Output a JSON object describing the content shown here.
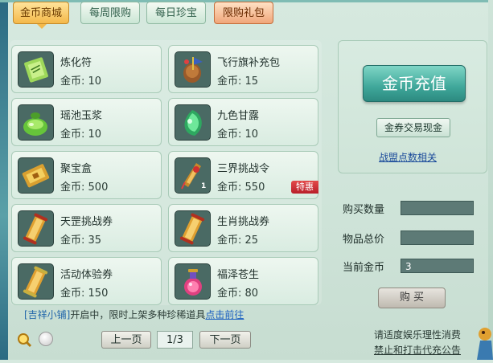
{
  "tabs": [
    {
      "label": "金币商城",
      "state": "active"
    },
    {
      "label": "每周限购",
      "state": "normal"
    },
    {
      "label": "每日珍宝",
      "state": "normal"
    },
    {
      "label": "限购礼包",
      "state": "highlight"
    }
  ],
  "currency_label": "金币:",
  "items": [
    {
      "name": "炼化符",
      "price": "10",
      "icon": "green-talisman-icon"
    },
    {
      "name": "飞行旗补充包",
      "price": "15",
      "icon": "flag-pack-icon"
    },
    {
      "name": "瑶池玉浆",
      "price": "10",
      "icon": "green-jade-pot-icon"
    },
    {
      "name": "九色甘露",
      "price": "10",
      "icon": "green-gem-dew-icon"
    },
    {
      "name": "聚宝盒",
      "price": "500",
      "icon": "treasure-box-icon"
    },
    {
      "name": "三界挑战令",
      "price": "550",
      "icon": "challenge-token-icon",
      "qty": "1",
      "badge": "特惠"
    },
    {
      "name": "天罡挑战券",
      "price": "35",
      "icon": "scroll-icon"
    },
    {
      "name": "生肖挑战券",
      "price": "25",
      "icon": "scroll-icon"
    },
    {
      "name": "活动体验券",
      "price": "150",
      "icon": "scroll-icon"
    },
    {
      "name": "福泽苍生",
      "price": "80",
      "icon": "potion-icon"
    }
  ],
  "notice": {
    "tag": "[吉祥小铺]",
    "text": "开启中，限时上架多种珍稀道具",
    "link": "点击前往"
  },
  "right_panel": {
    "recharge_label": "金币充值",
    "exchange_label": "金券交易现金",
    "alliance_link": "战盟点数相关"
  },
  "form": {
    "quantity_label": "购买数量",
    "quantity_value": "",
    "total_label": "物品总价",
    "total_value": "",
    "current_gold_label": "当前金币",
    "current_gold_value": "3"
  },
  "buy_label": "购 买",
  "pagination": {
    "prev_label": "上一页",
    "page_text": "1/3",
    "next_label": "下一页"
  },
  "footer": {
    "line1": "请适度娱乐理性消费",
    "line2": "禁止和打击代充公告"
  },
  "colors": {
    "background": "#d6e9df",
    "recharge_button": "#3fa79a",
    "sale_badge": "#c8283a",
    "link": "#1a5fc0"
  }
}
